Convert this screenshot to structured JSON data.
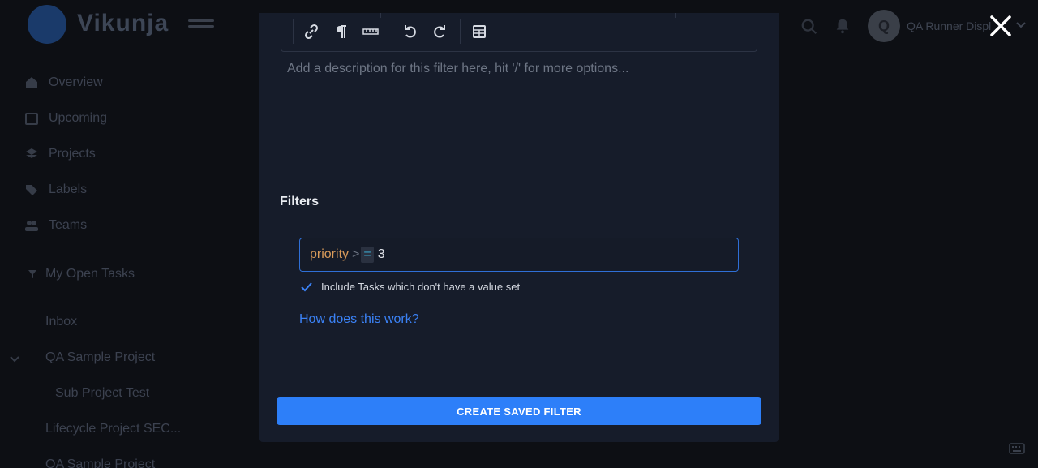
{
  "app": {
    "name": "Vikunja",
    "avatar_initial": "Q",
    "user_name": "QA Runner Displ"
  },
  "sidebar": {
    "items": [
      {
        "label": "Overview",
        "icon": "house-icon"
      },
      {
        "label": "Upcoming",
        "icon": "calendar-icon"
      },
      {
        "label": "Projects",
        "icon": "layers-icon"
      },
      {
        "label": "Labels",
        "icon": "tags-icon"
      },
      {
        "label": "Teams",
        "icon": "users-icon"
      }
    ],
    "saved_filter": "My Open Tasks",
    "projects": [
      "Inbox",
      "QA Sample Project",
      "Sub Project Test",
      "Lifecycle Project SEC...",
      "QA Sample Project"
    ]
  },
  "modal": {
    "description_placeholder": "Add a description for this filter here, hit '/' for more options...",
    "filters_heading": "Filters",
    "filter_query": {
      "field": "priority",
      "op1": ">",
      "op2": "=",
      "value": "3"
    },
    "include_nulls_label": "Include Tasks which don't have a value set",
    "include_nulls_checked": true,
    "help_link": "How does this work?",
    "submit_label": "CREATE SAVED FILTER"
  },
  "colors": {
    "accent": "#2d7ff9",
    "modal_bg": "#161c2a",
    "backdrop": "#0d0f14"
  }
}
